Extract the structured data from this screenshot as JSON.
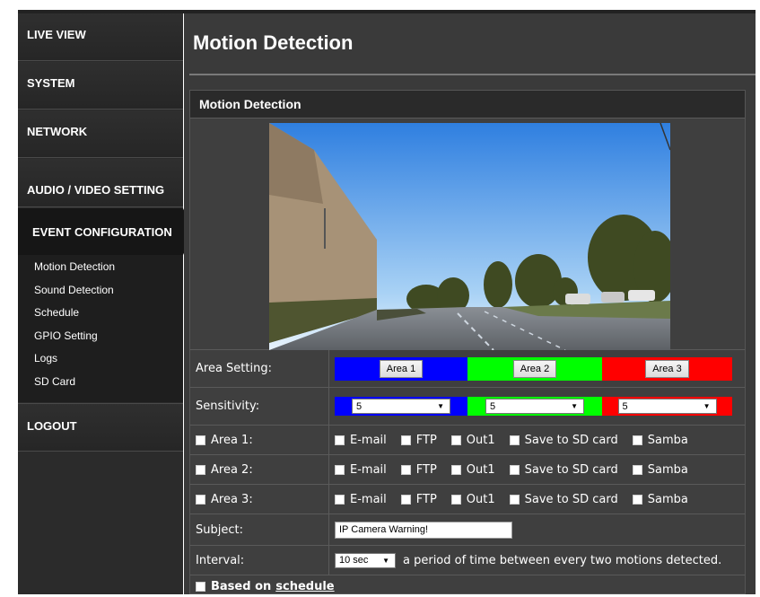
{
  "sidebar": {
    "items": [
      {
        "label": "LIVE VIEW"
      },
      {
        "label": "SYSTEM"
      },
      {
        "label": "NETWORK"
      },
      {
        "label": "AUDIO / VIDEO SETTING"
      },
      {
        "label": "EVENT CONFIGURATION"
      }
    ],
    "submenu": [
      {
        "label": "Motion Detection"
      },
      {
        "label": "Sound Detection"
      },
      {
        "label": "Schedule"
      },
      {
        "label": "GPIO Setting"
      },
      {
        "label": "Logs"
      },
      {
        "label": "SD Card"
      }
    ],
    "logout": "LOGOUT"
  },
  "page": {
    "title": "Motion Detection",
    "panel_title": "Motion Detection"
  },
  "area_setting": {
    "label": "Area Setting:",
    "buttons": [
      "Area 1",
      "Area 2",
      "Area 3"
    ],
    "colors": [
      "#0000ff",
      "#00ff00",
      "#ff0000"
    ]
  },
  "sensitivity": {
    "label": "Sensitivity:",
    "values": [
      "5",
      "5",
      "5"
    ]
  },
  "areas": [
    {
      "label": "Area 1:"
    },
    {
      "label": "Area 2:"
    },
    {
      "label": "Area 3:"
    }
  ],
  "actions": [
    "E-mail",
    "FTP",
    "Out1",
    "Save to SD card",
    "Samba"
  ],
  "subject": {
    "label": "Subject:",
    "value": "IP Camera Warning!"
  },
  "interval": {
    "label": "Interval:",
    "value": "10 sec",
    "description": "a period of time between every two motions detected."
  },
  "schedule": {
    "prefix": "Based on",
    "link": "schedule"
  }
}
